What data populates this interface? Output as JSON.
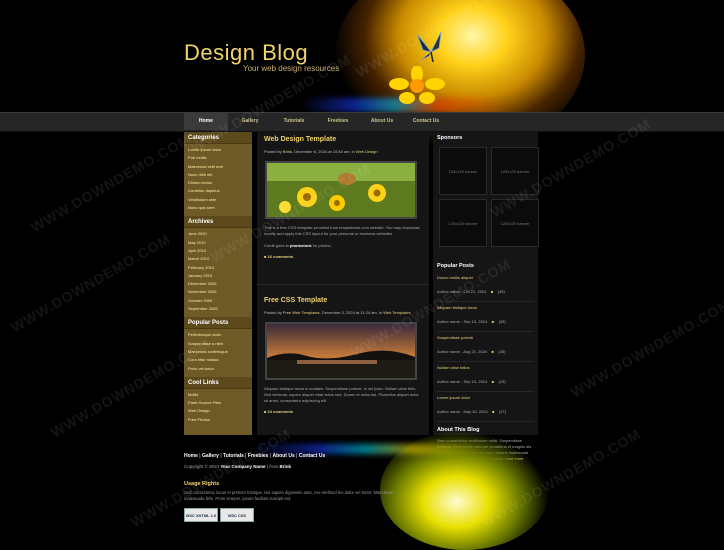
{
  "brand": {
    "title": "Design Blog",
    "tagline": "Your web design resources"
  },
  "nav": {
    "items": [
      "Home",
      "Gallery",
      "Tutorials",
      "Freebies",
      "About Us",
      "Contact Us"
    ]
  },
  "sidebar": {
    "categories_title": "Categories",
    "categories": [
      "Lorem ipsum dolor",
      "Pub mollis",
      "Maecenas velit erat",
      "Nunc nibh elit",
      "Dictum lectus",
      "Curabitur dapibus",
      "Vestibulum ante",
      "Nunc quis sem"
    ],
    "archives_title": "Archives",
    "archives": [
      "June 2010",
      "May 2010",
      "April 2010",
      "March 2010",
      "February 2010",
      "January 2010",
      "December 2009",
      "November 2009",
      "October 2009",
      "September 2009"
    ],
    "popular_title": "Popular Posts",
    "popular": [
      "Pellentesque dolor",
      "Suspendisse a nibh",
      "Maecenas scelerisque",
      "Cura bitur massa",
      "Proin vel tortor"
    ],
    "links_title": "Cool Links",
    "links": [
      "Mollis",
      "Flash Source Files",
      "Web Design",
      "Free Photos"
    ]
  },
  "posts": [
    {
      "title": "Web Design Template",
      "meta_prefix": "Posted by",
      "author": "Brink",
      "meta_mid": ", December 6, 2024 at 10:48 am, in",
      "category": "Web Design",
      "text1": "This is a free CSS template provided from templatemo.com website. You may download, modify and apply this CSS layout for your personal or business websites.",
      "text2_a": "Credit goes to",
      "text2_link": "photostock",
      "text2_b": "for photos.",
      "comments": "16 comments"
    },
    {
      "title": "Free CSS Template",
      "meta_prefix": "Posted by",
      "author": "Free Web Templates",
      "meta_mid": ", December 3, 2024 at 11:24 am, in",
      "category": "Web Templates",
      "text1": "Aliquam tristique lacus in sodales. Suspendisse potenti. In vel justo. Nullam vitae felis. Sed vehicula, sapien aliquet vitae tellus sed. Donec et nulla nisi. Phasellus aliquet dolor sit amet, consectetur adipiscing elit.",
      "comments": "24 comments"
    }
  ],
  "right": {
    "sponsors_title": "Sponsors",
    "ad_label": "125x125 banner",
    "popular_title": "Popular Posts",
    "popular": [
      {
        "title": "Donec mollis aliquet",
        "meta": "Author name - Oct 21, 2024",
        "count": "(45)"
      },
      {
        "title": "Aliquam tristique lacus",
        "meta": "Author name - Sep 15, 2024",
        "count": "(35)"
      },
      {
        "title": "Suspendisse potenti",
        "meta": "Author name - Aug 21, 2024",
        "count": "(28)"
      },
      {
        "title": "Nullam vitae tellus",
        "meta": "Author name - Sep 15, 2024",
        "count": "(15)"
      },
      {
        "title": "Lorem ipsum dolor",
        "meta": "Author name - May 16, 2024",
        "count": "(27)"
      }
    ],
    "about_title": "About This Blog",
    "about_text": "Nam consectetur vestibulum nulla. Suspendisse pulvinar. Cum sociis natoque penatibus et magnis dis parturient montes nascetur mus. Mauris malesuada dolor sit amet tristique suscipit lacinia.",
    "about_more": "read more"
  },
  "footer": {
    "links": [
      "Home",
      "Gallery",
      "Tutorials",
      "Freebies",
      "About Us",
      "Contact Us"
    ],
    "copy_a": "Copyright © 2024",
    "company": "Your Company Name",
    "copy_b": "| from",
    "copy_author": "Brink",
    "usage_title": "Usage Rights",
    "usage_text": "Sed consectetur, lacus et pretium tristique, nisi sapien dignissim ante, nec eleifend leo dolor vel tortor. Maecenas malesuada felis. Proin semper, ipsum facilisis suscipit est.",
    "badges": [
      "W3C XHTML 1.0",
      "W3C CSS"
    ]
  },
  "watermark": "WWW.DOWNDEMO.COM",
  "colors": {
    "accent": "#f0d46a",
    "sidebar": "#6e5a26",
    "panel": "#151515"
  }
}
